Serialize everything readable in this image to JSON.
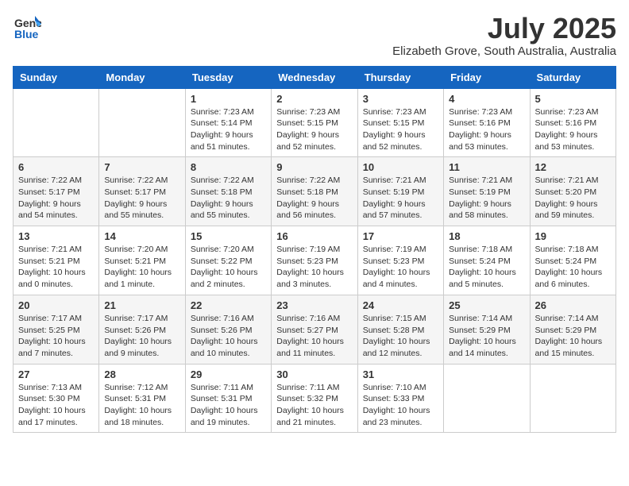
{
  "logo": {
    "general": "General",
    "blue": "Blue"
  },
  "title": "July 2025",
  "subtitle": "Elizabeth Grove, South Australia, Australia",
  "days_of_week": [
    "Sunday",
    "Monday",
    "Tuesday",
    "Wednesday",
    "Thursday",
    "Friday",
    "Saturday"
  ],
  "weeks": [
    [
      {
        "day": "",
        "info": ""
      },
      {
        "day": "",
        "info": ""
      },
      {
        "day": "1",
        "info": "Sunrise: 7:23 AM\nSunset: 5:14 PM\nDaylight: 9 hours and 51 minutes."
      },
      {
        "day": "2",
        "info": "Sunrise: 7:23 AM\nSunset: 5:15 PM\nDaylight: 9 hours and 52 minutes."
      },
      {
        "day": "3",
        "info": "Sunrise: 7:23 AM\nSunset: 5:15 PM\nDaylight: 9 hours and 52 minutes."
      },
      {
        "day": "4",
        "info": "Sunrise: 7:23 AM\nSunset: 5:16 PM\nDaylight: 9 hours and 53 minutes."
      },
      {
        "day": "5",
        "info": "Sunrise: 7:23 AM\nSunset: 5:16 PM\nDaylight: 9 hours and 53 minutes."
      }
    ],
    [
      {
        "day": "6",
        "info": "Sunrise: 7:22 AM\nSunset: 5:17 PM\nDaylight: 9 hours and 54 minutes."
      },
      {
        "day": "7",
        "info": "Sunrise: 7:22 AM\nSunset: 5:17 PM\nDaylight: 9 hours and 55 minutes."
      },
      {
        "day": "8",
        "info": "Sunrise: 7:22 AM\nSunset: 5:18 PM\nDaylight: 9 hours and 55 minutes."
      },
      {
        "day": "9",
        "info": "Sunrise: 7:22 AM\nSunset: 5:18 PM\nDaylight: 9 hours and 56 minutes."
      },
      {
        "day": "10",
        "info": "Sunrise: 7:21 AM\nSunset: 5:19 PM\nDaylight: 9 hours and 57 minutes."
      },
      {
        "day": "11",
        "info": "Sunrise: 7:21 AM\nSunset: 5:19 PM\nDaylight: 9 hours and 58 minutes."
      },
      {
        "day": "12",
        "info": "Sunrise: 7:21 AM\nSunset: 5:20 PM\nDaylight: 9 hours and 59 minutes."
      }
    ],
    [
      {
        "day": "13",
        "info": "Sunrise: 7:21 AM\nSunset: 5:21 PM\nDaylight: 10 hours and 0 minutes."
      },
      {
        "day": "14",
        "info": "Sunrise: 7:20 AM\nSunset: 5:21 PM\nDaylight: 10 hours and 1 minute."
      },
      {
        "day": "15",
        "info": "Sunrise: 7:20 AM\nSunset: 5:22 PM\nDaylight: 10 hours and 2 minutes."
      },
      {
        "day": "16",
        "info": "Sunrise: 7:19 AM\nSunset: 5:23 PM\nDaylight: 10 hours and 3 minutes."
      },
      {
        "day": "17",
        "info": "Sunrise: 7:19 AM\nSunset: 5:23 PM\nDaylight: 10 hours and 4 minutes."
      },
      {
        "day": "18",
        "info": "Sunrise: 7:18 AM\nSunset: 5:24 PM\nDaylight: 10 hours and 5 minutes."
      },
      {
        "day": "19",
        "info": "Sunrise: 7:18 AM\nSunset: 5:24 PM\nDaylight: 10 hours and 6 minutes."
      }
    ],
    [
      {
        "day": "20",
        "info": "Sunrise: 7:17 AM\nSunset: 5:25 PM\nDaylight: 10 hours and 7 minutes."
      },
      {
        "day": "21",
        "info": "Sunrise: 7:17 AM\nSunset: 5:26 PM\nDaylight: 10 hours and 9 minutes."
      },
      {
        "day": "22",
        "info": "Sunrise: 7:16 AM\nSunset: 5:26 PM\nDaylight: 10 hours and 10 minutes."
      },
      {
        "day": "23",
        "info": "Sunrise: 7:16 AM\nSunset: 5:27 PM\nDaylight: 10 hours and 11 minutes."
      },
      {
        "day": "24",
        "info": "Sunrise: 7:15 AM\nSunset: 5:28 PM\nDaylight: 10 hours and 12 minutes."
      },
      {
        "day": "25",
        "info": "Sunrise: 7:14 AM\nSunset: 5:29 PM\nDaylight: 10 hours and 14 minutes."
      },
      {
        "day": "26",
        "info": "Sunrise: 7:14 AM\nSunset: 5:29 PM\nDaylight: 10 hours and 15 minutes."
      }
    ],
    [
      {
        "day": "27",
        "info": "Sunrise: 7:13 AM\nSunset: 5:30 PM\nDaylight: 10 hours and 17 minutes."
      },
      {
        "day": "28",
        "info": "Sunrise: 7:12 AM\nSunset: 5:31 PM\nDaylight: 10 hours and 18 minutes."
      },
      {
        "day": "29",
        "info": "Sunrise: 7:11 AM\nSunset: 5:31 PM\nDaylight: 10 hours and 19 minutes."
      },
      {
        "day": "30",
        "info": "Sunrise: 7:11 AM\nSunset: 5:32 PM\nDaylight: 10 hours and 21 minutes."
      },
      {
        "day": "31",
        "info": "Sunrise: 7:10 AM\nSunset: 5:33 PM\nDaylight: 10 hours and 23 minutes."
      },
      {
        "day": "",
        "info": ""
      },
      {
        "day": "",
        "info": ""
      }
    ]
  ]
}
